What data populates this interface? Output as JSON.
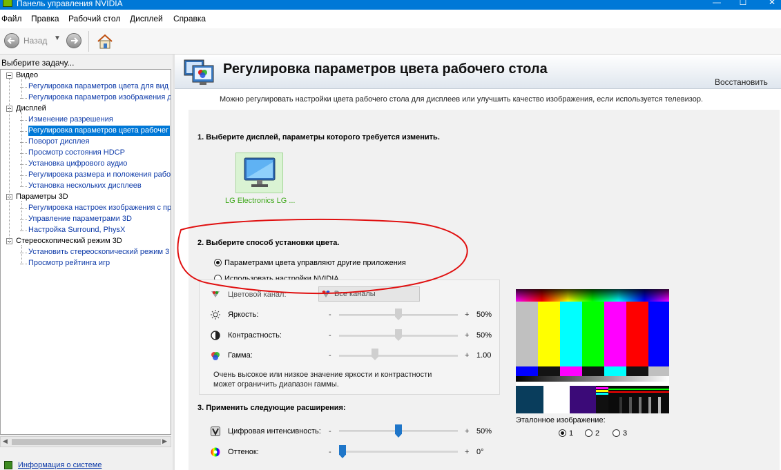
{
  "window": {
    "title": "Панель управления NVIDIA",
    "minimize": "—",
    "maximize": "☐",
    "close": "✕"
  },
  "menu": [
    "Файл",
    "Правка",
    "Рабочий стол",
    "Дисплей",
    "Справка"
  ],
  "toolbar": {
    "back_label": "Назад"
  },
  "left": {
    "header": "Выберите задачу...",
    "tree": [
      {
        "label": "Видео",
        "type": "category"
      },
      {
        "label": "Регулировка параметров цвета для вид",
        "type": "leaf"
      },
      {
        "label": "Регулировка параметров изображения д",
        "type": "leaf"
      },
      {
        "label": "Дисплей",
        "type": "category"
      },
      {
        "label": "Изменение разрешения",
        "type": "leaf"
      },
      {
        "label": "Регулировка параметров цвета рабочег",
        "type": "leaf",
        "selected": true
      },
      {
        "label": "Поворот дисплея",
        "type": "leaf"
      },
      {
        "label": "Просмотр состояния HDCP",
        "type": "leaf"
      },
      {
        "label": "Установка цифрового аудио",
        "type": "leaf"
      },
      {
        "label": "Регулировка размера и положения рабо",
        "type": "leaf"
      },
      {
        "label": "Установка нескольких дисплеев",
        "type": "leaf"
      },
      {
        "label": "Параметры 3D",
        "type": "category"
      },
      {
        "label": "Регулировка настроек изображения с пр",
        "type": "leaf"
      },
      {
        "label": "Управление параметрами 3D",
        "type": "leaf"
      },
      {
        "label": "Настройка Surround, PhysX",
        "type": "leaf"
      },
      {
        "label": "Стереоскопический режим 3D",
        "type": "category"
      },
      {
        "label": "Установить стереоскопический режим 3",
        "type": "leaf"
      },
      {
        "label": "Просмотр рейтинга игр",
        "type": "leaf"
      }
    ],
    "sysinfo": "Информация о системе"
  },
  "main": {
    "title": "Регулировка параметров цвета рабочего стола",
    "restore": "Восстановить",
    "description": "Можно регулировать настройки цвета рабочего стола для дисплеев или улучшить качество изображения, если используется телевизор.",
    "section1": "1. Выберите дисплей, параметры которого требуется изменить.",
    "display_name": "LG Electronics LG ...",
    "section2": "2. Выберите способ установки цвета.",
    "radio_other": "Параметрами цвета управляют другие приложения",
    "radio_nvidia": "Использовать настройки NVIDIA",
    "color_channel_label": "Цветовой канал:",
    "color_channel_value": "Все каналы",
    "brightness": {
      "label": "Яркость:",
      "value": "50%",
      "level": 0.5
    },
    "contrast": {
      "label": "Контрастность:",
      "value": "50%",
      "level": 0.5
    },
    "gamma": {
      "label": "Гамма:",
      "value": "1.00",
      "level": 0.29
    },
    "minus": "-",
    "plus": "+",
    "note": "Очень высокое или низкое значение яркости и контрастности может ограничить диапазон гаммы.",
    "section3": "3. Применить следующие расширения:",
    "vibrance": {
      "label": "Цифровая интенсивность:",
      "value": "50%",
      "level": 0.5
    },
    "hue": {
      "label": "Оттенок:",
      "value": "0°",
      "level": 0.0
    },
    "reference_label": "Эталонное изображение:",
    "reference_options": [
      "1",
      "2",
      "3"
    ]
  },
  "colors": {
    "accent": "#0078d7",
    "nvidia_green": "#76b900",
    "annotation": "#e01010",
    "link": "#0d3aa8"
  }
}
